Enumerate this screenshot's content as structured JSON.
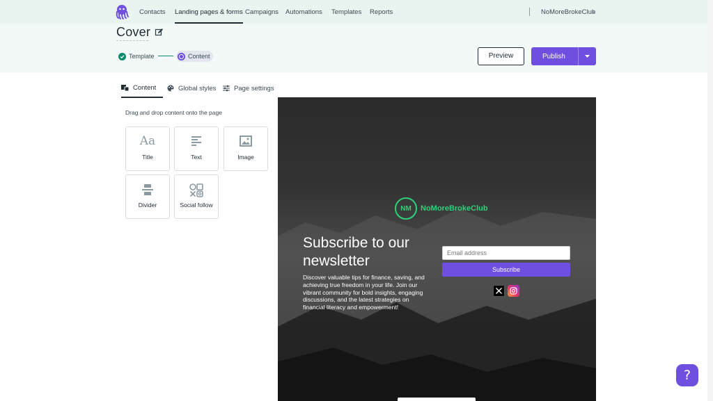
{
  "nav": {
    "items": [
      {
        "label": "Contacts",
        "active": false
      },
      {
        "label": "Landing pages & forms",
        "active": true
      },
      {
        "label": "Campaigns",
        "active": false
      },
      {
        "label": "Automations",
        "active": false
      },
      {
        "label": "Templates",
        "active": false
      },
      {
        "label": "Reports",
        "active": false
      }
    ],
    "account_name": "NoMoreBrokeClub"
  },
  "header": {
    "title": "Cover",
    "steps": [
      {
        "label": "Template",
        "state": "done"
      },
      {
        "label": "Content",
        "state": "current"
      }
    ],
    "preview_label": "Preview",
    "publish_label": "Publish"
  },
  "tabs": [
    {
      "label": "Content",
      "active": true
    },
    {
      "label": "Global styles",
      "active": false
    },
    {
      "label": "Page settings",
      "active": false
    }
  ],
  "blocks": {
    "help_text": "Drag and drop content onto the page",
    "items": [
      {
        "label": "Title",
        "icon": "title-icon"
      },
      {
        "label": "Text",
        "icon": "text-icon"
      },
      {
        "label": "Image",
        "icon": "image-icon"
      },
      {
        "label": "Divider",
        "icon": "divider-icon"
      },
      {
        "label": "Social follow",
        "icon": "social-follow-icon"
      }
    ]
  },
  "preview": {
    "brand_name": "NoMoreBrokeClub",
    "brand_monogram": "NM",
    "title": "Subscribe to our newsletter",
    "body": "Discover valuable tips for finance, saving, and achieving true freedom in your life. Join our vibrant community for bold insights, engaging discussions, and the latest strategies on financial literacy and empowerment!",
    "email_placeholder": "Email address",
    "subscribe_label": "Subscribe",
    "social": [
      "x-icon",
      "instagram-icon"
    ]
  },
  "help_button_label": "?",
  "colors": {
    "accent": "#6e4fe0",
    "brand_green": "#2fd07a",
    "step_done": "#0b8a6b",
    "nav_bg": "#e9f3f0",
    "header_bg": "#f3f9f7"
  }
}
